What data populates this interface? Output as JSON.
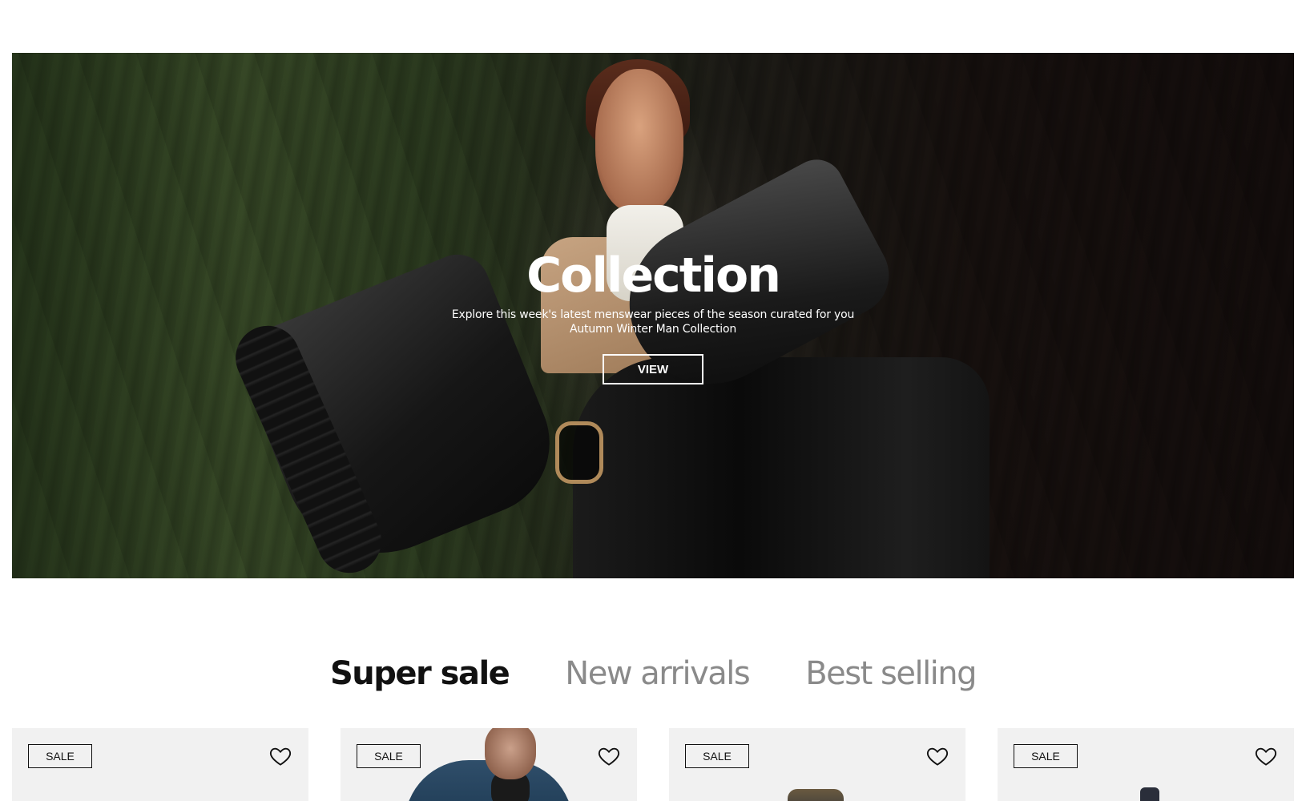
{
  "hero": {
    "title": "Collection",
    "subtitle_line1": "Explore this week's latest menswear pieces of the season curated for you",
    "subtitle_line2": "Autumn Winter Man Collection",
    "cta_label": "VIEW"
  },
  "tabs": [
    {
      "label": "Super sale",
      "active": true
    },
    {
      "label": "New arrivals",
      "active": false
    },
    {
      "label": "Best selling",
      "active": false
    }
  ],
  "products": [
    {
      "badge": "SALE",
      "favorite_icon": "heart-outline-icon"
    },
    {
      "badge": "SALE",
      "favorite_icon": "heart-outline-icon"
    },
    {
      "badge": "SALE",
      "favorite_icon": "heart-outline-icon"
    },
    {
      "badge": "SALE",
      "favorite_icon": "heart-outline-icon"
    }
  ],
  "colors": {
    "text": "#111111",
    "inactive_tab": "#8a8a8a",
    "card_bg": "#f1f1f1",
    "hero_text": "#ffffff"
  }
}
